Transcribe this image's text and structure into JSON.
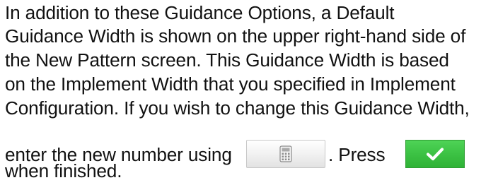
{
  "paragraph": {
    "lines": [
      "In addition to these Guidance Options, a Default",
      "Guidance Width is shown on the upper right-hand side of",
      "the New Pattern screen. This Guidance Width is based",
      "on the Implement Width that you specified in Implement",
      "Configuration. If you wish to change this Guidance Width,"
    ],
    "inline_before_calc": "enter the new number using",
    "inline_after_calc": ". Press",
    "last_line": "when finished."
  },
  "icons": {
    "calculator": "calculator-icon",
    "confirm": "checkmark-icon"
  },
  "colors": {
    "confirm_green": "#3cc244",
    "calc_button_gray": "#f0f0f0"
  }
}
